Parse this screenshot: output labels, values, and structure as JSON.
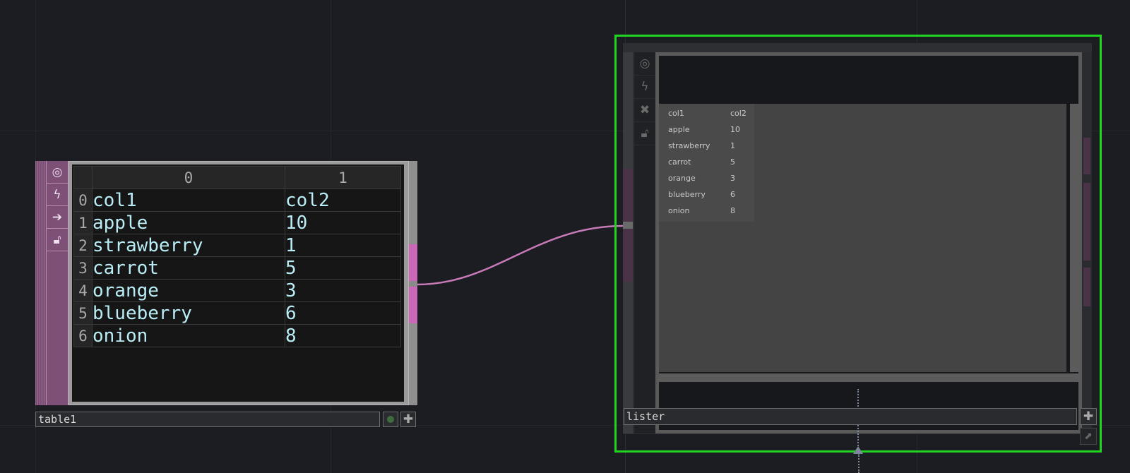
{
  "colors": {
    "background": "#1b1d22",
    "table_node_accent": "#cc66b9",
    "selection_outline": "#22d422",
    "cell_text": "#b9ecf5",
    "wire": "#c87ab8"
  },
  "table1": {
    "name": "table1",
    "header_columns": [
      "0",
      "1"
    ],
    "rows": [
      {
        "index": "0",
        "c0": "col1",
        "c1": "col2"
      },
      {
        "index": "1",
        "c0": "apple",
        "c1": "10"
      },
      {
        "index": "2",
        "c0": "strawberry",
        "c1": "1"
      },
      {
        "index": "3",
        "c0": "carrot",
        "c1": "5"
      },
      {
        "index": "4",
        "c0": "orange",
        "c1": "3"
      },
      {
        "index": "5",
        "c0": "blueberry",
        "c1": "6"
      },
      {
        "index": "6",
        "c0": "onion",
        "c1": "8"
      }
    ],
    "flags": {
      "viewer_icon": "target-icon",
      "cook_icon": "lightning-icon",
      "export_icon": "arrow-right-icon",
      "lock_icon": "lock-icon",
      "display_icon": "green-dot-icon",
      "add_icon": "plus-icon"
    }
  },
  "lister": {
    "name": "lister",
    "rows": [
      {
        "a": "col1",
        "b": "col2"
      },
      {
        "a": "apple",
        "b": "10"
      },
      {
        "a": "strawberry",
        "b": "1"
      },
      {
        "a": "carrot",
        "b": "5"
      },
      {
        "a": "orange",
        "b": "3"
      },
      {
        "a": "blueberry",
        "b": "6"
      },
      {
        "a": "onion",
        "b": "8"
      }
    ],
    "flags": {
      "viewer_icon": "target-icon",
      "cook_icon": "lightning-icon",
      "bypass_icon": "x-icon",
      "lock_icon": "lock-icon",
      "add_icon": "plus-icon",
      "expand_icon": "diagonal-arrow-icon"
    }
  }
}
